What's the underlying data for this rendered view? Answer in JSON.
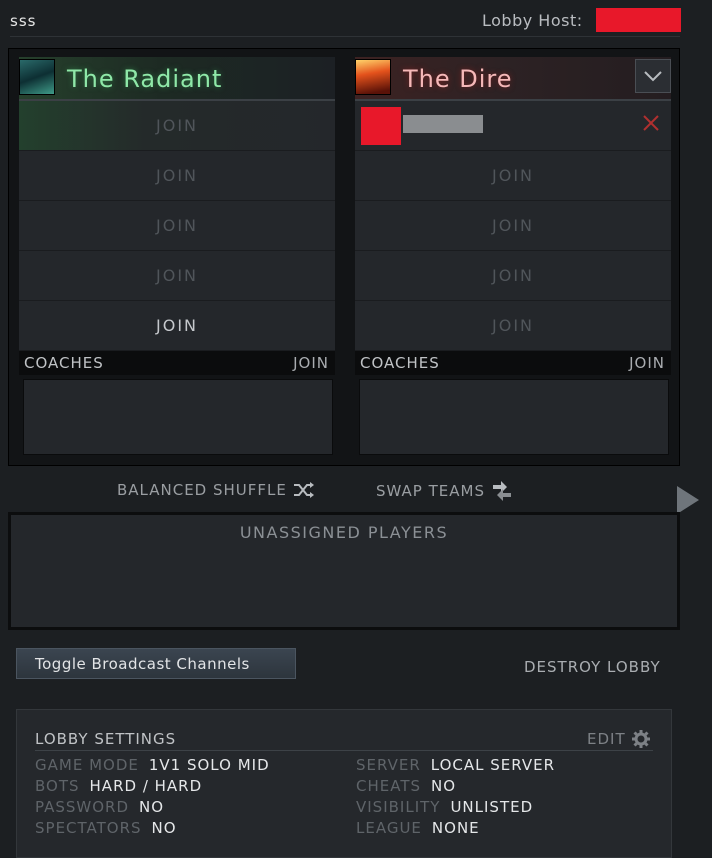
{
  "lobby": {
    "name": "sss",
    "host_label": "Lobby Host:"
  },
  "radiant": {
    "name": "The Radiant",
    "slots": [
      "JOIN",
      "JOIN",
      "JOIN",
      "JOIN",
      "JOIN"
    ],
    "coaches_label": "COACHES",
    "coaches_join": "JOIN"
  },
  "dire": {
    "name": "The Dire",
    "slots": [
      "JOIN",
      "JOIN",
      "JOIN",
      "JOIN"
    ],
    "coaches_label": "COACHES",
    "coaches_join": "JOIN"
  },
  "actions": {
    "balanced_shuffle": "BALANCED SHUFFLE",
    "swap_teams": "SWAP TEAMS",
    "unassigned_title": "UNASSIGNED PLAYERS",
    "toggle_broadcast": "Toggle Broadcast Channels",
    "destroy_lobby": "DESTROY LOBBY"
  },
  "settings": {
    "title": "LOBBY SETTINGS",
    "edit": "EDIT",
    "left": [
      {
        "label": "GAME MODE",
        "value": "1V1 SOLO MID"
      },
      {
        "label": "BOTS",
        "value": "HARD / HARD"
      },
      {
        "label": "PASSWORD",
        "value": "NO"
      },
      {
        "label": "SPECTATORS",
        "value": "NO"
      }
    ],
    "right": [
      {
        "label": "SERVER",
        "value": "LOCAL SERVER"
      },
      {
        "label": "CHEATS",
        "value": "NO"
      },
      {
        "label": "VISIBILITY",
        "value": "UNLISTED"
      },
      {
        "label": "LEAGUE",
        "value": "NONE"
      }
    ]
  },
  "colors": {
    "radiant_accent": "#8fe8a8",
    "dire_accent": "#f5b8b8",
    "redaction": "#e8182a",
    "kick_icon": "#b03030"
  },
  "icons": {
    "radiant": "radiant-team-icon",
    "dire": "dire-team-icon",
    "dropdown": "chevron-down-icon",
    "kick": "close-icon",
    "shuffle": "shuffle-icon",
    "swap": "swap-icon",
    "expand": "play-arrow-icon",
    "settings": "gear-icon"
  }
}
